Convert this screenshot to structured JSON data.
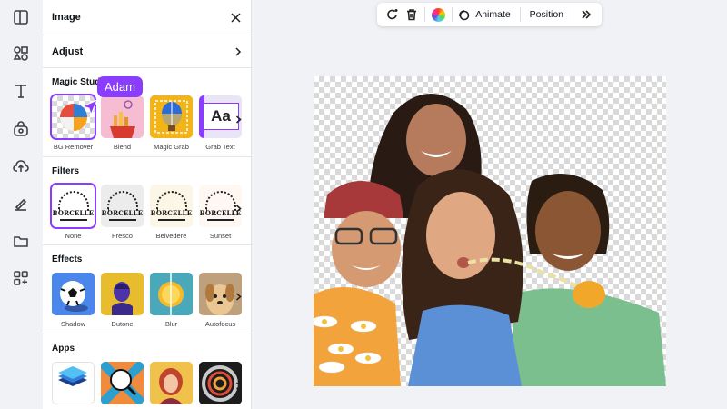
{
  "panel": {
    "title": "Image",
    "adjust_label": "Adjust"
  },
  "magic_studio": {
    "title": "Magic Stud",
    "tools": [
      {
        "label": "BG Remover"
      },
      {
        "label": "Blend"
      },
      {
        "label": "Magic Grab"
      },
      {
        "label": "Grab Text"
      }
    ],
    "thumb_text": "Aa"
  },
  "filters": {
    "title": "Filters",
    "items": [
      {
        "label": "None"
      },
      {
        "label": "Fresco"
      },
      {
        "label": "Belvedere"
      },
      {
        "label": "Sunset"
      }
    ],
    "thumb_text": "BORCELLE"
  },
  "effects": {
    "title": "Effects",
    "items": [
      {
        "label": "Shadow"
      },
      {
        "label": "Dutone"
      },
      {
        "label": "Blur"
      },
      {
        "label": "Autofocus"
      }
    ]
  },
  "apps": {
    "title": "Apps"
  },
  "collaborator": {
    "name": "Adam",
    "color": "#8b3dff"
  },
  "toolbar": {
    "animate_label": "Animate",
    "position_label": "Position"
  },
  "colors": {
    "accent": "#8b3dff",
    "rail_bg": "#f1f2f5"
  }
}
